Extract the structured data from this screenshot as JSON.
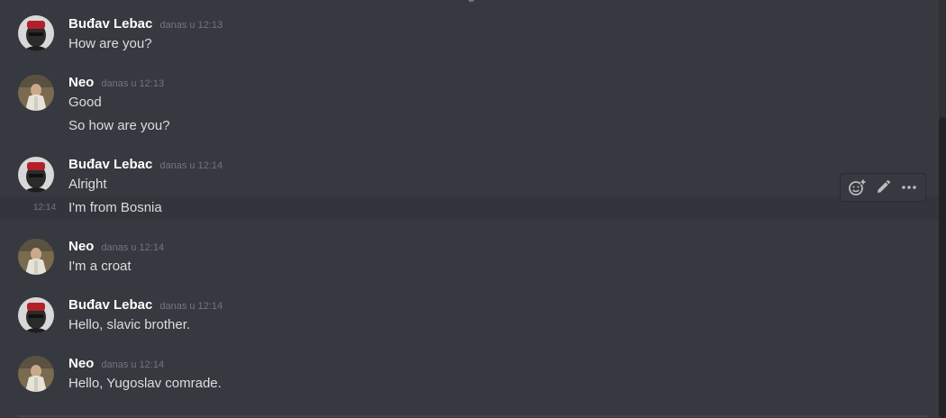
{
  "messages": [
    {
      "author": "Buđav Lebac",
      "timestamp": "danas u 12:13",
      "lines": [
        "How are you?"
      ]
    },
    {
      "author": "Neo",
      "timestamp": "danas u 12:13",
      "lines": [
        "Good",
        "So how are you?"
      ]
    },
    {
      "author": "Buđav Lebac",
      "timestamp": "danas u 12:14",
      "lines": [
        "Alright",
        "I'm from Bosnia"
      ],
      "hover_time": "12:14"
    },
    {
      "author": "Neo",
      "timestamp": "danas u 12:14",
      "lines": [
        "I'm a croat"
      ]
    },
    {
      "author": "Buđav Lebac",
      "timestamp": "danas u 12:14",
      "lines": [
        "Hello, slavic brother."
      ]
    },
    {
      "author": "Neo",
      "timestamp": "danas u 12:14",
      "lines": [
        "Hello, Yugoslav comrade."
      ]
    }
  ],
  "toolbar": {
    "icons": [
      "add-reaction-icon",
      "edit-pencil-icon",
      "more-options-icon"
    ]
  },
  "colors": {
    "background": "#36393f",
    "username": "#ffffff",
    "message_text": "#dcddde",
    "timestamp": "#72767d",
    "hover_row": "#32353b"
  }
}
